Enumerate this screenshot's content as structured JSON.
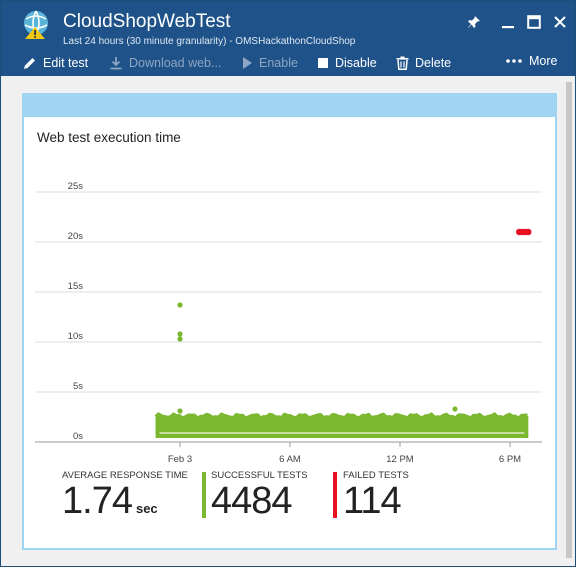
{
  "window": {
    "title": "CloudShopWebTest",
    "subtitle": "Last 24 hours (30 minute granularity) - OMSHackathonCloudShop"
  },
  "toolbar": {
    "edit": "Edit test",
    "download": "Download web...",
    "enable": "Enable",
    "disable": "Disable",
    "delete": "Delete",
    "more": "More"
  },
  "card": {
    "title": "Web test execution time"
  },
  "chart_data": {
    "type": "scatter",
    "title": "Web test execution time",
    "y_ticks": [
      "25s",
      "20s",
      "15s",
      "10s",
      "5s",
      "0s"
    ],
    "x_ticks": [
      "Feb 3",
      "6 AM",
      "12 PM",
      "6 PM"
    ],
    "ylim": [
      0,
      25
    ],
    "grid": true,
    "series": [
      {
        "color": "#7cb82f",
        "band": {
          "x_start": "Feb 2 22:40",
          "x_end": "Feb 3 19:00",
          "y_min": 0.4,
          "y_max": 2.6
        },
        "outliers": [
          {
            "x": "Feb 3 00:00",
            "y": 13.7
          },
          {
            "x": "Feb 3 00:00",
            "y": 10.8
          },
          {
            "x": "Feb 3 00:00",
            "y": 10.3
          },
          {
            "x": "Feb 3 00:00",
            "y": 3.1
          },
          {
            "x": "Feb 3 15:00",
            "y": 3.3
          }
        ]
      },
      {
        "color": "#e81123",
        "points": [
          {
            "x": "Feb 3 18:30",
            "y": 21.0
          },
          {
            "x": "Feb 3 18:40",
            "y": 21.0
          },
          {
            "x": "Feb 3 18:50",
            "y": 21.0
          },
          {
            "x": "Feb 3 19:00",
            "y": 21.0
          }
        ]
      }
    ]
  },
  "stats": {
    "avg_label": "AVERAGE RESPONSE TIME",
    "avg_value": "1.74",
    "avg_unit": "sec",
    "success_label": "SUCCESSFUL TESTS",
    "success_value": "4484",
    "success_color": "#7cb82f",
    "failed_label": "FAILED TESTS",
    "failed_value": "114",
    "failed_color": "#e81123"
  }
}
